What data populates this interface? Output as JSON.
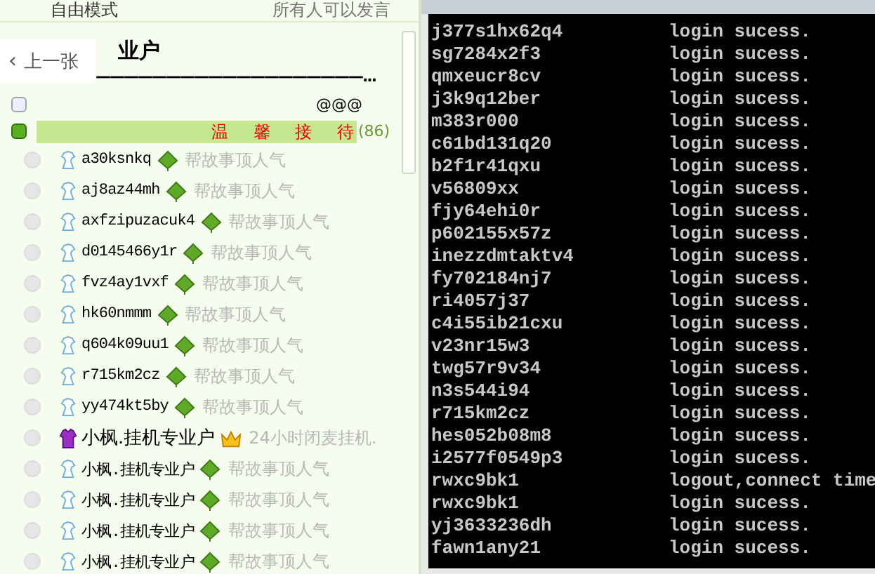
{
  "header": {
    "mode": "自由模式",
    "permission": "所有人可以发言"
  },
  "overlay": {
    "arrow": "‹",
    "label": "上一张"
  },
  "channel": {
    "name": "业户",
    "rule": "———————————————————...",
    "tag": "@@@",
    "expanded": false
  },
  "group": {
    "name": "温 馨 接 待",
    "count": "(86)",
    "expanded": true
  },
  "members": [
    {
      "name": "a30ksnkq",
      "kind": "leaf",
      "note": "帮故事顶人气"
    },
    {
      "name": "aj8az44mh",
      "kind": "leaf",
      "note": "帮故事顶人气"
    },
    {
      "name": "axfzipuzacuk4",
      "kind": "leaf",
      "note": "帮故事顶人气"
    },
    {
      "name": "d0145466y1r",
      "kind": "leaf",
      "note": "帮故事顶人气"
    },
    {
      "name": "fvz4ay1vxf",
      "kind": "leaf",
      "note": "帮故事顶人气"
    },
    {
      "name": "hk60nmmm",
      "kind": "leaf",
      "note": "帮故事顶人气"
    },
    {
      "name": "q604k09uu1",
      "kind": "leaf",
      "note": "帮故事顶人气"
    },
    {
      "name": "r715km2cz",
      "kind": "leaf",
      "note": "帮故事顶人气"
    },
    {
      "name": "yy474kt5by",
      "kind": "leaf",
      "note": "帮故事顶人气"
    },
    {
      "name": "小枫.挂机专业户",
      "kind": "crown",
      "note": "24小时闭麦挂机."
    },
    {
      "name": "小枫.挂机专业户",
      "kind": "leaf",
      "note": "帮故事顶人气"
    },
    {
      "name": "小枫.挂机专业户",
      "kind": "leaf",
      "note": "帮故事顶人气"
    },
    {
      "name": "小枫.挂机专业户",
      "kind": "leaf",
      "note": "帮故事顶人气"
    },
    {
      "name": "小枫.挂机专业户",
      "kind": "leaf",
      "note": "帮故事顶人气"
    }
  ],
  "console": [
    {
      "user": "j377s1hx62q4",
      "message": "login sucess."
    },
    {
      "user": "sg7284x2f3",
      "message": "login sucess."
    },
    {
      "user": "qmxeucr8cv",
      "message": "login sucess."
    },
    {
      "user": "j3k9q12ber",
      "message": "login sucess."
    },
    {
      "user": "m383r000",
      "message": "login sucess."
    },
    {
      "user": "c61bd131q20",
      "message": "login sucess."
    },
    {
      "user": "b2f1r41qxu",
      "message": "login sucess."
    },
    {
      "user": "v56809xx",
      "message": "login sucess."
    },
    {
      "user": "fjy64ehi0r",
      "message": "login sucess."
    },
    {
      "user": "p602155x57z",
      "message": "login sucess."
    },
    {
      "user": "inezzdmtaktv4",
      "message": "login sucess."
    },
    {
      "user": "fy702184nj7",
      "message": "login sucess."
    },
    {
      "user": "ri4057j37",
      "message": "login sucess."
    },
    {
      "user": "c4i55ib21cxu",
      "message": "login sucess."
    },
    {
      "user": "v23nr15w3",
      "message": "login sucess."
    },
    {
      "user": "twg57r9v34",
      "message": "login sucess."
    },
    {
      "user": "n3s544i94",
      "message": "login sucess."
    },
    {
      "user": "r715km2cz",
      "message": "login sucess."
    },
    {
      "user": "hes052b08m8",
      "message": "login sucess."
    },
    {
      "user": "i2577f0549p3",
      "message": "login sucess."
    },
    {
      "user": "rwxc9bk1",
      "message": "logout,connect time"
    },
    {
      "user": "rwxc9bk1",
      "message": "login sucess."
    },
    {
      "user": "yj3633236dh",
      "message": "login sucess."
    },
    {
      "user": "fawn1any21",
      "message": "login sucess."
    }
  ]
}
